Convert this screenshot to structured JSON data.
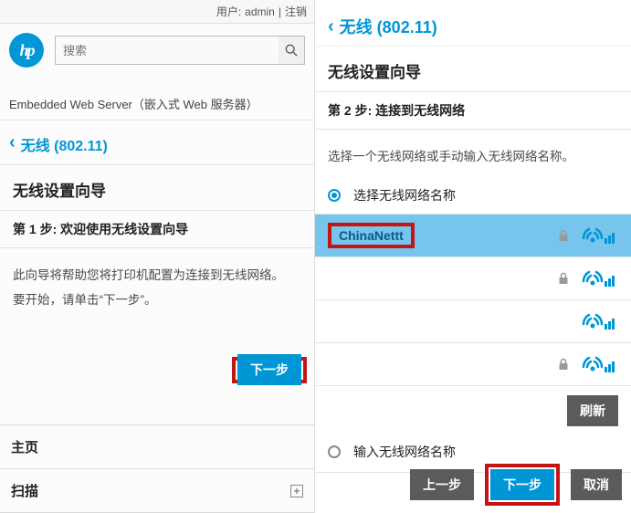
{
  "left": {
    "userbar": {
      "user_label": "用户:",
      "user_value": "admin",
      "logout": "注销"
    },
    "search": {
      "placeholder": "搜索"
    },
    "ews_label": "Embedded Web Server（嵌入式 Web 服务器）",
    "breadcrumb": "无线 (802.11)",
    "wizard_title": "无线设置向导",
    "step_title": "第 1 步: 欢迎使用无线设置向导",
    "body_line1": "此向导将帮助您将打印机配置为连接到无线网络。",
    "body_line2": "要开始，请单击“下一步”。",
    "next_button": "下一步",
    "menu": {
      "home": "主页",
      "scan": "扫描"
    }
  },
  "right": {
    "breadcrumb": "无线 (802.11)",
    "wizard_title": "无线设置向导",
    "step_title": "第 2 步: 连接到无线网络",
    "instruction": "选择一个无线网络或手动输入无线网络名称。",
    "radio_select_label": "选择无线网络名称",
    "networks": [
      {
        "name": "ChinaNettt",
        "locked": true,
        "highlight": true,
        "selected": true
      },
      {
        "name": "",
        "locked": true,
        "highlight": false,
        "selected": false
      },
      {
        "name": "",
        "locked": false,
        "highlight": false,
        "selected": false
      },
      {
        "name": "",
        "locked": true,
        "highlight": false,
        "selected": false
      }
    ],
    "refresh_button": "刷新",
    "radio_manual_label": "输入无线网络名称",
    "buttons": {
      "prev": "上一步",
      "next": "下一步",
      "cancel": "取消"
    }
  },
  "colors": {
    "accent": "#0096d6",
    "highlight_red": "#c41515"
  }
}
